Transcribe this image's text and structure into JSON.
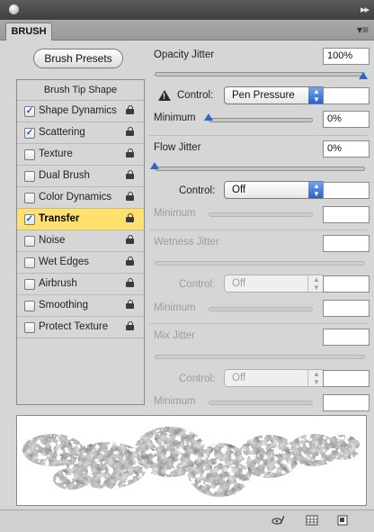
{
  "tab": {
    "label": "BRUSH"
  },
  "presets": {
    "label": "Brush Presets"
  },
  "left": {
    "header": "Brush Tip Shape",
    "items": [
      {
        "label": "Shape Dynamics",
        "checked": true,
        "selected": false
      },
      {
        "label": "Scattering",
        "checked": true,
        "selected": false
      },
      {
        "label": "Texture",
        "checked": false,
        "selected": false
      },
      {
        "label": "Dual Brush",
        "checked": false,
        "selected": false
      },
      {
        "label": "Color Dynamics",
        "checked": false,
        "selected": false
      },
      {
        "label": "Transfer",
        "checked": true,
        "selected": true
      },
      {
        "label": "Noise",
        "checked": false,
        "selected": false
      },
      {
        "label": "Wet Edges",
        "checked": false,
        "selected": false
      },
      {
        "label": "Airbrush",
        "checked": false,
        "selected": false
      },
      {
        "label": "Smoothing",
        "checked": false,
        "selected": false
      },
      {
        "label": "Protect Texture",
        "checked": false,
        "selected": false
      }
    ]
  },
  "opacity": {
    "label": "Opacity Jitter",
    "value": "100%",
    "jitter_fraction": 1.0,
    "control_label": "Control:",
    "control_value": "Pen Pressure",
    "min_label": "Minimum",
    "min_value": "0%",
    "min_fraction": 0.0
  },
  "flow": {
    "label": "Flow Jitter",
    "value": "0%",
    "jitter_fraction": 0.0,
    "control_label": "Control:",
    "control_value": "Off",
    "min_label": "Minimum"
  },
  "wetness": {
    "label": "Wetness Jitter",
    "control_label": "Control:",
    "control_value": "Off",
    "min_label": "Minimum"
  },
  "mix": {
    "label": "Mix Jitter",
    "control_label": "Control:",
    "control_value": "Off",
    "min_label": "Minimum"
  },
  "colors": {
    "accent": "#2a66d6",
    "selected_row": "#ffe170",
    "panel": "#d6d6d6"
  },
  "icons": [
    "warning-icon",
    "lock-icon",
    "eye-brush-icon",
    "grid-icon",
    "new-preset-icon"
  ]
}
